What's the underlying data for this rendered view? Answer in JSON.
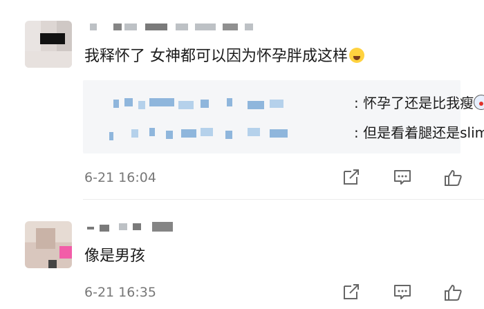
{
  "comments": [
    {
      "text": "我释怀了 女神都可以因为怀孕胖成这样",
      "emoji": "crying-laughing-emoji",
      "timestamp": "6-21 16:04",
      "replies": [
        {
          "separator": ":",
          "text": "怀孕了还是比我瘦",
          "emoji": "dizzy-face-emoji"
        },
        {
          "separator": ":",
          "text": "但是看着腿还是slim"
        }
      ]
    },
    {
      "text": "像是男孩",
      "timestamp": "6-21 16:35"
    }
  ],
  "icons": {
    "share": "share-icon",
    "reply": "comment-icon",
    "like": "thumbs-up-icon"
  },
  "colors": {
    "text": "#1a1a1a",
    "meta": "#777777",
    "reply_bg": "#f5f6f8",
    "icon": "#666666"
  }
}
